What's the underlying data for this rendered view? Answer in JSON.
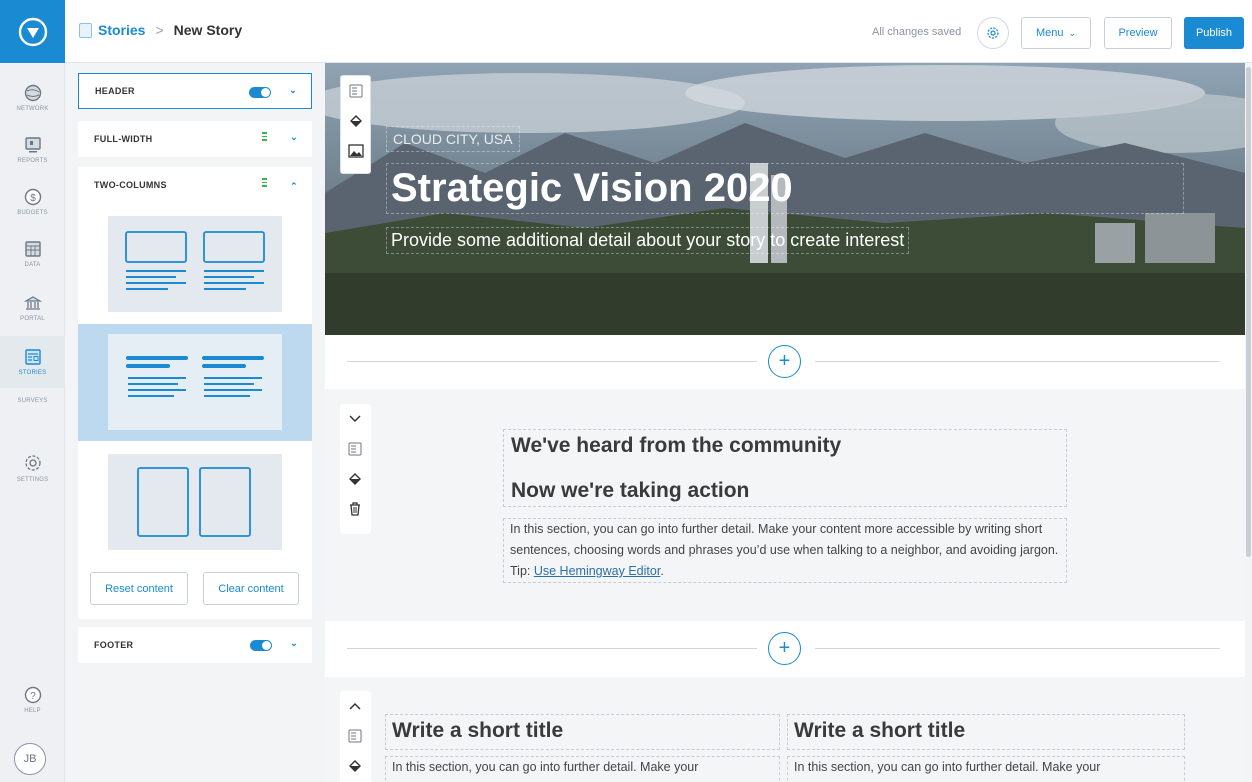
{
  "nav": {
    "items": [
      {
        "label": "NETWORK",
        "icon": "globe-icon"
      },
      {
        "label": "REPORTS",
        "icon": "monitor-icon"
      },
      {
        "label": "BUDGETS",
        "icon": "dollar-icon"
      },
      {
        "label": "DATA",
        "icon": "table-icon"
      },
      {
        "label": "PORTAL",
        "icon": "building-icon"
      },
      {
        "label": "STORIES",
        "icon": "stories-icon"
      },
      {
        "label": "SURVEYS",
        "icon": ""
      },
      {
        "label": "SETTINGS",
        "icon": "gear-icon"
      },
      {
        "label": "HELP",
        "icon": "question-icon"
      }
    ],
    "avatar_initials": "JB"
  },
  "header": {
    "breadcrumb_root": "Stories",
    "breadcrumb_sep": ">",
    "breadcrumb_current": "New Story",
    "save_status": "All changes saved",
    "menu_label": "Menu",
    "preview_label": "Preview",
    "publish_label": "Publish"
  },
  "layout_panel": {
    "sections": [
      {
        "label": "HEADER",
        "toggle_on": true
      },
      {
        "label": "FULL-WIDTH"
      },
      {
        "label": "TWO-COLUMNS",
        "expanded": true
      },
      {
        "label": "FOOTER",
        "toggle_on": true
      }
    ],
    "reset_label": "Reset content",
    "clear_label": "Clear content"
  },
  "hero": {
    "eyebrow": "CLOUD CITY, USA",
    "title": "Strategic Vision 2020",
    "subtitle": "Provide some additional detail about your story to create interest"
  },
  "section1": {
    "heading1": "We've heard from the community",
    "heading2": "Now we're taking action",
    "body": "In this section, you can go into further detail. Make your content more accessible by writing short sentences, choosing words and phrases you’d use when talking to a neighbor, and avoiding jargon. Tip: ",
    "link": "Use Hemingway Editor",
    "body_end": "."
  },
  "section2": {
    "col1_title": "Write a short title",
    "col1_body": "In this section, you can go into further detail. Make your",
    "col2_title": "Write a short title",
    "col2_body": "In this section, you can go into further detail. Make your"
  },
  "colors": {
    "accent": "#1a8ad3",
    "toggle_green": "#39b54a"
  }
}
